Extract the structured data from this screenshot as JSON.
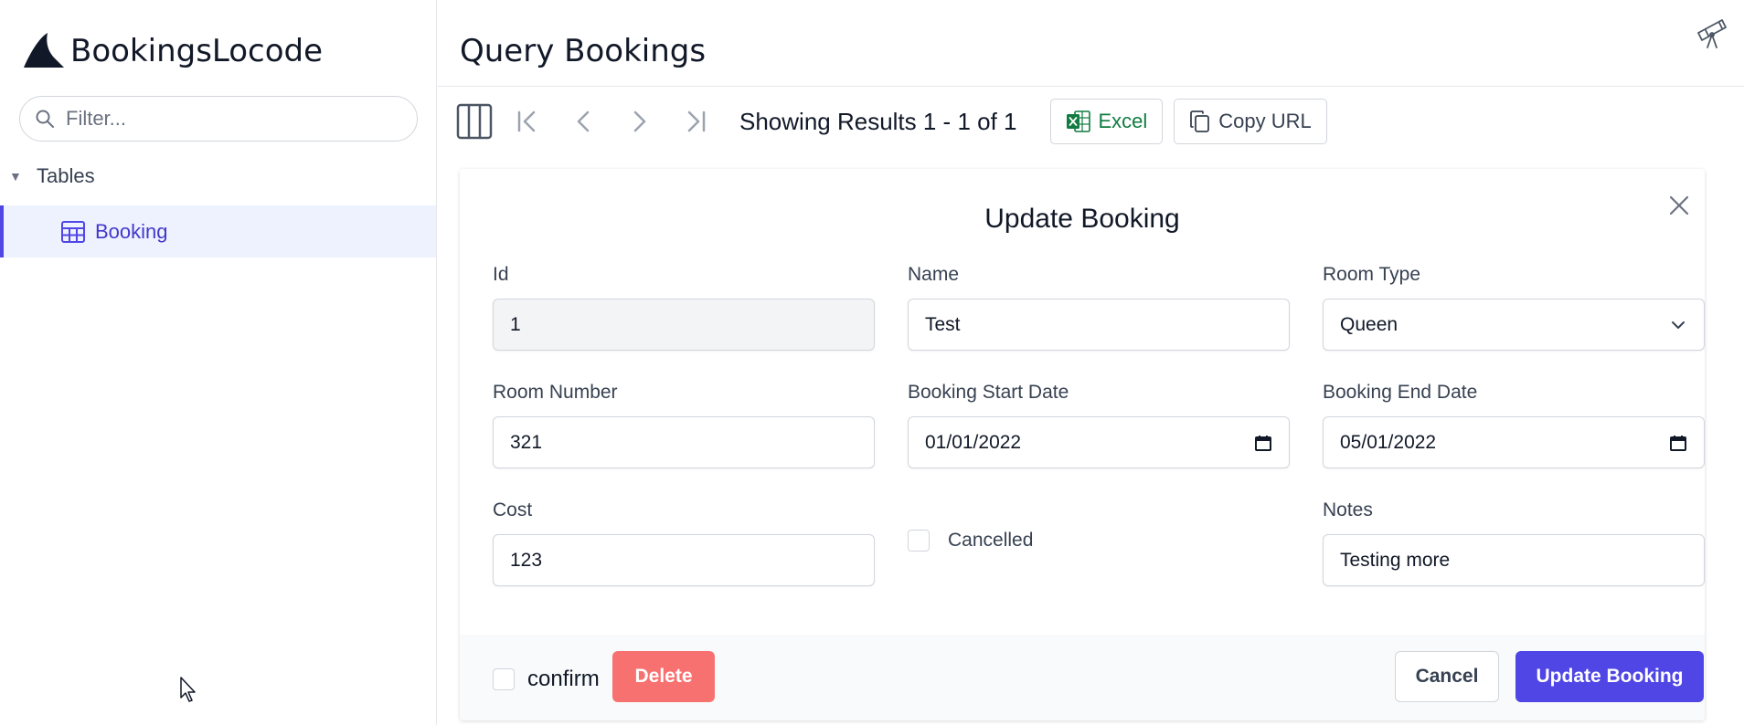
{
  "app": {
    "name": "BookingsLocode"
  },
  "sidebar": {
    "filter_placeholder": "Filter...",
    "group_label": "Tables",
    "items": [
      {
        "label": "Booking",
        "active": true
      }
    ]
  },
  "header": {
    "title": "Query Bookings"
  },
  "toolbar": {
    "results_text": "Showing Results 1 - 1 of 1",
    "excel_label": "Excel",
    "copy_url_label": "Copy URL"
  },
  "form": {
    "title": "Update Booking",
    "fields": {
      "id": {
        "label": "Id",
        "value": "1"
      },
      "name": {
        "label": "Name",
        "value": "Test"
      },
      "room_type": {
        "label": "Room Type",
        "value": "Queen"
      },
      "room_number": {
        "label": "Room Number",
        "value": "321"
      },
      "booking_start_date": {
        "label": "Booking Start Date",
        "value": "01/01/2022"
      },
      "booking_end_date": {
        "label": "Booking End Date",
        "value": "05/01/2022"
      },
      "cost": {
        "label": "Cost",
        "value": "123"
      },
      "cancelled": {
        "label": "Cancelled",
        "checked": false
      },
      "notes": {
        "label": "Notes",
        "value": "Testing more"
      }
    },
    "footer": {
      "confirm_label": "confirm",
      "delete_label": "Delete",
      "cancel_label": "Cancel",
      "submit_label": "Update Booking"
    }
  },
  "colors": {
    "accent": "#4f46e5",
    "accent_bg": "#eef2ff",
    "danger": "#f87171",
    "excel_green": "#107c41"
  }
}
